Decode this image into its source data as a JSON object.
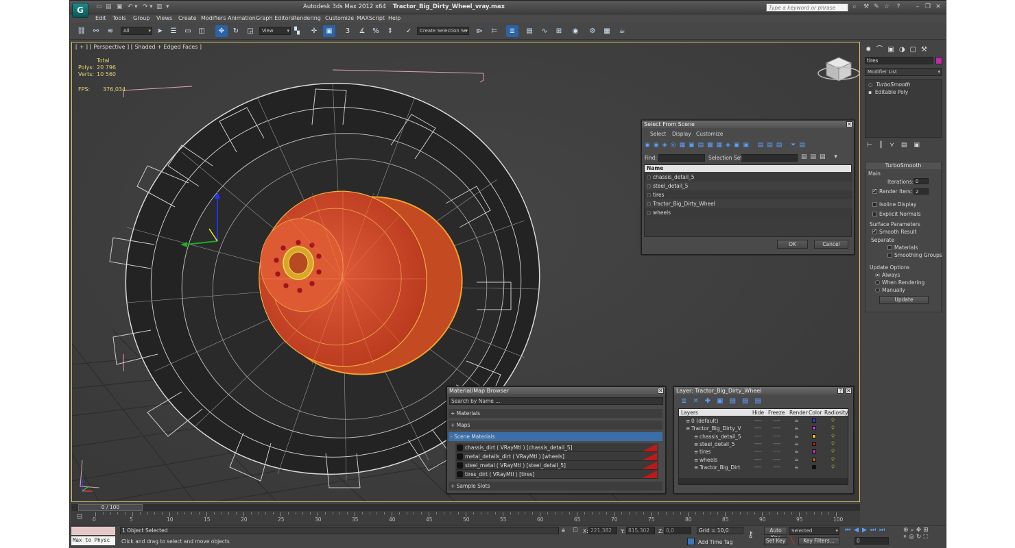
{
  "app": {
    "name": "Autodesk 3ds Max  2012 x64",
    "file": "Tractor_Big_Dirty_Wheel_vray.max",
    "search_placeholder": "Type a keyword or phrase"
  },
  "menu": [
    "Edit",
    "Tools",
    "Group",
    "Views",
    "Create",
    "Modifiers",
    "Animation",
    "Graph Editors",
    "Rendering",
    "Customize",
    "MAXScript",
    "Help"
  ],
  "toolbar": {
    "selection_filter": "All",
    "ref_coord": "View",
    "named_selection": "Create Selection Se"
  },
  "viewport": {
    "label": "[ + ] [ Perspective ] [ Shaded + Edged Faces ]",
    "stats_header": "Total",
    "polys_label": "Polys:",
    "polys_value": "20 796",
    "verts_label": "Verts:",
    "verts_value": "10 560",
    "fps_label": "FPS:",
    "fps_value": "376,034"
  },
  "command_panel": {
    "object_name": "tires",
    "object_color": "#c12aa8",
    "modifier_list": "Modifier List",
    "stack": [
      "TurboSmooth",
      "Editable Poly"
    ],
    "turbosmooth": {
      "title": "TurboSmooth",
      "main": "Main",
      "iterations_label": "Iterations:",
      "iterations_value": "0",
      "render_iters_label": "Render Iters:",
      "render_iters_value": "2",
      "isoline": "Isoline Display",
      "explicit": "Explicit Normals",
      "surface_params": "Surface Parameters",
      "smooth_result": "Smooth Result",
      "separate": "Separate",
      "materials": "Materials",
      "smoothing_groups": "Smoothing Groups",
      "update_options": "Update Options",
      "always": "Always",
      "when_rendering": "When Rendering",
      "manually": "Manually",
      "update_btn": "Update"
    }
  },
  "select_dialog": {
    "title": "Select From Scene",
    "menus": [
      "Select",
      "Display",
      "Customize"
    ],
    "find_label": "Find:",
    "selset_label": "Selection Set:",
    "col_name": "Name",
    "items": [
      "chassis_detail_5",
      "steel_detail_5",
      "tires",
      "Tractor_Big_Dirty_Wheel",
      "wheels"
    ],
    "ok": "OK",
    "cancel": "Cancel"
  },
  "material_browser": {
    "title": "Material/Map Browser",
    "search": "Search by Name ...",
    "materials": "+ Materials",
    "maps": "+ Maps",
    "scene_materials": "- Scene Materials",
    "items": [
      "chassis_dirt  ( VRayMtl ) [chassis_detail_5]",
      "metal_details_dirt  ( VRayMtl ) [wheels]",
      "steel_metal  ( VRayMtl ) [steel_detail_5]",
      "tires_dirt  ( VRayMtl ) [tires]"
    ],
    "sample_slots": "+ Sample Slots"
  },
  "layer_dialog": {
    "title": "Layer: Tractor_Big_Dirty_Wheel",
    "cols": [
      "Layers",
      "Hide",
      "Freeze",
      "Render",
      "Color",
      "Radiosity"
    ],
    "rows": [
      {
        "name": "0 (default)",
        "color": "#3a3acc",
        "indent": 0
      },
      {
        "name": "Tractor_Big_Dirty_V",
        "color": "#c13ad8",
        "indent": 0
      },
      {
        "name": "chassis_detail_5",
        "color": "#e5c21a",
        "indent": 1
      },
      {
        "name": "steel_detail_5",
        "color": "#b11d1d",
        "indent": 1
      },
      {
        "name": "tires",
        "color": "#c12aa8",
        "indent": 1
      },
      {
        "name": "wheels",
        "color": "#a06622",
        "indent": 1
      },
      {
        "name": "Tractor_Big_Dirt",
        "color": "#111111",
        "indent": 1
      }
    ],
    "dash": "----"
  },
  "timeline": {
    "frame": "0 / 100",
    "ticks": [
      "0",
      "5",
      "10",
      "15",
      "20",
      "25",
      "30",
      "35",
      "40",
      "45",
      "50",
      "55",
      "60",
      "65",
      "70",
      "75",
      "80",
      "85",
      "90",
      "95",
      "100"
    ]
  },
  "status": {
    "maxscript": "Max to Physc",
    "selected": "1 Object Selected",
    "prompt": "Click and drag to select and move objects",
    "x_label": "X:",
    "x": "221,382",
    "y_label": "Y:",
    "y": "815,302",
    "z_label": "Z:",
    "z": "0,0",
    "grid": "Grid = 10,0",
    "add_time_tag": "Add Time Tag",
    "auto_key": "Auto Key",
    "set_key": "Set Key",
    "key_mode": "Selected",
    "key_filters": "Key Filters...",
    "frame_field": "0"
  }
}
